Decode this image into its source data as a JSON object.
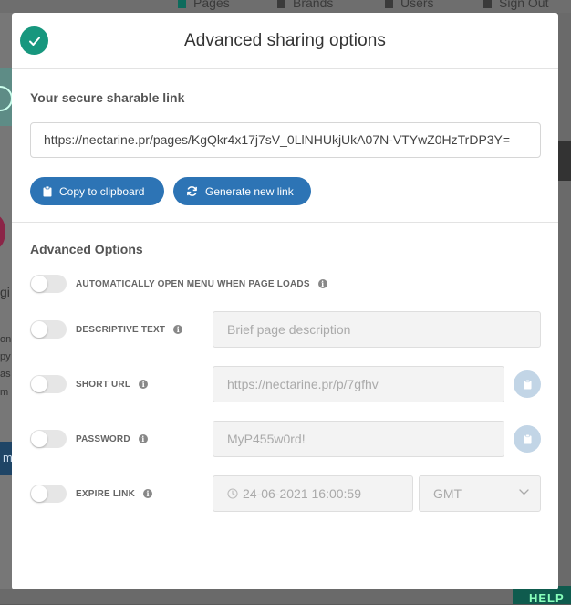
{
  "background": {
    "nav": [
      {
        "label": "Pages",
        "active": true
      },
      {
        "label": "Brands",
        "active": false
      },
      {
        "label": "Users",
        "active": false
      },
      {
        "label": "Sign Out",
        "active": false
      }
    ],
    "left_fragments": [
      "gi",
      "on",
      "py",
      "as",
      "m",
      "m"
    ],
    "help_label": "HELP"
  },
  "modal": {
    "title": "Advanced sharing options",
    "link_section": {
      "label": "Your secure sharable link",
      "url": "https://nectarine.pr/pages/KgQkr4x17j7sV_0LlNHUkjUkA07N-VTYwZ0HzTrDP3Y=",
      "copy_label": "Copy to clipboard",
      "generate_label": "Generate new link"
    },
    "advanced": {
      "label": "Advanced Options",
      "auto_open": {
        "label": "AUTOMATICALLY OPEN MENU WHEN PAGE LOADS",
        "enabled": false
      },
      "descriptive": {
        "label": "DESCRIPTIVE TEXT",
        "enabled": false,
        "placeholder": "Brief page description"
      },
      "short_url": {
        "label": "SHORT URL",
        "enabled": false,
        "value": "https://nectarine.pr/p/7gfhv"
      },
      "password": {
        "label": "PASSWORD",
        "enabled": false,
        "value": "MyP455w0rd!"
      },
      "expire": {
        "label": "EXPIRE LINK",
        "enabled": false,
        "datetime": "24-06-2021 16:00:59",
        "timezone": "GMT"
      }
    }
  },
  "colors": {
    "accent_green": "#17977e",
    "button_blue": "#2d74b5",
    "clip_button": "#c2d5e6"
  }
}
